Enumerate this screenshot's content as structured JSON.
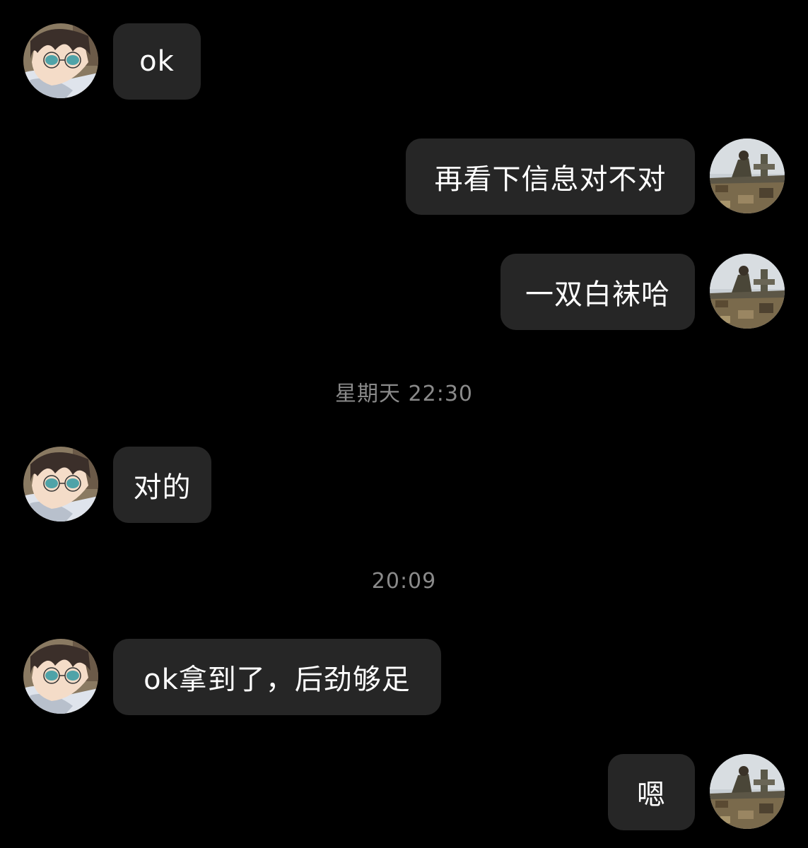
{
  "messages": [
    {
      "sender": "contact",
      "avatar": "anime-boy-with-glasses-avatar",
      "text": "ok"
    },
    {
      "sender": "self",
      "avatar": "soldier-on-vehicle-avatar",
      "text": "再看下信息对不对"
    },
    {
      "sender": "self",
      "avatar": "soldier-on-vehicle-avatar",
      "text": "一双白袜哈"
    },
    {
      "type": "timestamp",
      "text": "星期天 22:30"
    },
    {
      "sender": "contact",
      "avatar": "anime-boy-with-glasses-avatar",
      "text": "对的"
    },
    {
      "type": "timestamp",
      "text": "20:09"
    },
    {
      "sender": "contact",
      "avatar": "anime-boy-with-glasses-avatar",
      "text": "ok拿到了，后劲够足"
    },
    {
      "sender": "self",
      "avatar": "soldier-on-vehicle-avatar",
      "text": "嗯"
    }
  ],
  "colors": {
    "background": "#000000",
    "bubble": "#262626",
    "message_text": "#ffffff",
    "timestamp_text": "#8a8a8a"
  }
}
